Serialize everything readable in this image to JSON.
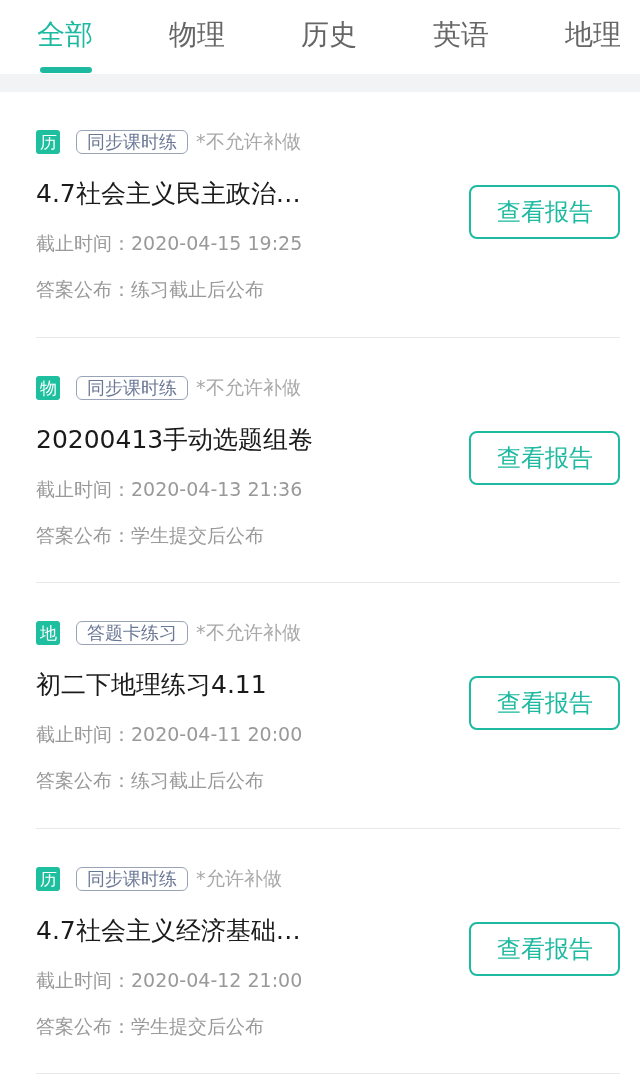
{
  "tabs": [
    {
      "label": "全部",
      "selected": true
    },
    {
      "label": "物理",
      "selected": false
    },
    {
      "label": "历史",
      "selected": false
    },
    {
      "label": "英语",
      "selected": false
    },
    {
      "label": "地理",
      "selected": false
    }
  ],
  "assignments": [
    {
      "subject": "历",
      "type": "同步课时练",
      "makeup": "*不允许补做",
      "title": "4.7社会主义民主政治…",
      "deadline": "截止时间：2020-04-15 19:25",
      "answer": "答案公布：练习截止后公布",
      "button": "查看报告"
    },
    {
      "subject": "物",
      "type": "同步课时练",
      "makeup": "*不允许补做",
      "title": "20200413手动选题组卷",
      "deadline": "截止时间：2020-04-13 21:36",
      "answer": "答案公布：学生提交后公布",
      "button": "查看报告"
    },
    {
      "subject": "地",
      "type": "答题卡练习",
      "makeup": "*不允许补做",
      "title": "初二下地理练习4.11",
      "deadline": "截止时间：2020-04-11 20:00",
      "answer": "答案公布：练习截止后公布",
      "button": "查看报告"
    },
    {
      "subject": "历",
      "type": "同步课时练",
      "makeup": "*允许补做",
      "title": "4.7社会主义经济基础…",
      "deadline": "截止时间：2020-04-12 21:00",
      "answer": "答案公布：学生提交后公布",
      "button": "查看报告"
    }
  ]
}
